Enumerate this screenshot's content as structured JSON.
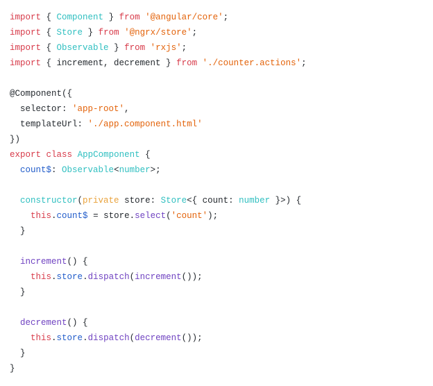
{
  "code": {
    "l1": {
      "import": "import",
      "ob": "{ ",
      "Component": "Component",
      "cb": " }",
      "from": "from",
      "mod": "'@angular/core'",
      "semi": ";"
    },
    "l2": {
      "import": "import",
      "ob": "{ ",
      "Store": "Store",
      "cb": " }",
      "from": "from",
      "mod": "'@ngrx/store'",
      "semi": ";"
    },
    "l3": {
      "import": "import",
      "ob": "{ ",
      "Observable": "Observable",
      "cb": " }",
      "from": "from",
      "mod": "'rxjs'",
      "semi": ";"
    },
    "l4": {
      "import": "import",
      "ob": "{ increment, decrement }",
      "from": "from",
      "mod": "'./counter.actions'",
      "semi": ";"
    },
    "l6": {
      "dec": "@Component({"
    },
    "l7": {
      "key": "  selector:",
      "val": "'app-root'",
      "comma": ","
    },
    "l8": {
      "key": "  templateUrl:",
      "val": "'./app.component.html'"
    },
    "l9": {
      "close": "})"
    },
    "l10": {
      "export": "export",
      "class": "class",
      "name": "AppComponent",
      "ob": " {"
    },
    "l11": {
      "prop": "count$",
      "colon": ": ",
      "type1": "Observable",
      "lt": "<",
      "type2": "number",
      "gt": ">;"
    },
    "l13": {
      "ctor": "constructor",
      "p1": "(",
      "priv": "private",
      "sp": " ",
      "param": "store",
      "colon": ": ",
      "Store": "Store",
      "lt": "<{ count: ",
      "num": "number",
      "gt": " }>",
      "p2": ") {"
    },
    "l14": {
      "this": "this",
      "dot": ".",
      "prop": "count$",
      "eq": " = store.",
      "sel": "select",
      "arg": "(",
      "str": "'count'",
      "end": ");"
    },
    "l15": {
      "close": "  }"
    },
    "l17": {
      "name": "increment",
      "paren": "() {"
    },
    "l18": {
      "this": "this",
      "d1": ".",
      "store": "store",
      "d2": ".",
      "disp": "dispatch",
      "p1": "(",
      "call": "increment",
      "p2": "());"
    },
    "l19": {
      "close": "  }"
    },
    "l21": {
      "name": "decrement",
      "paren": "() {"
    },
    "l22": {
      "this": "this",
      "d1": ".",
      "store": "store",
      "d2": ".",
      "disp": "dispatch",
      "p1": "(",
      "call": "decrement",
      "p2": "());"
    },
    "l23": {
      "close": "  }"
    },
    "l24": {
      "close": "}"
    }
  }
}
